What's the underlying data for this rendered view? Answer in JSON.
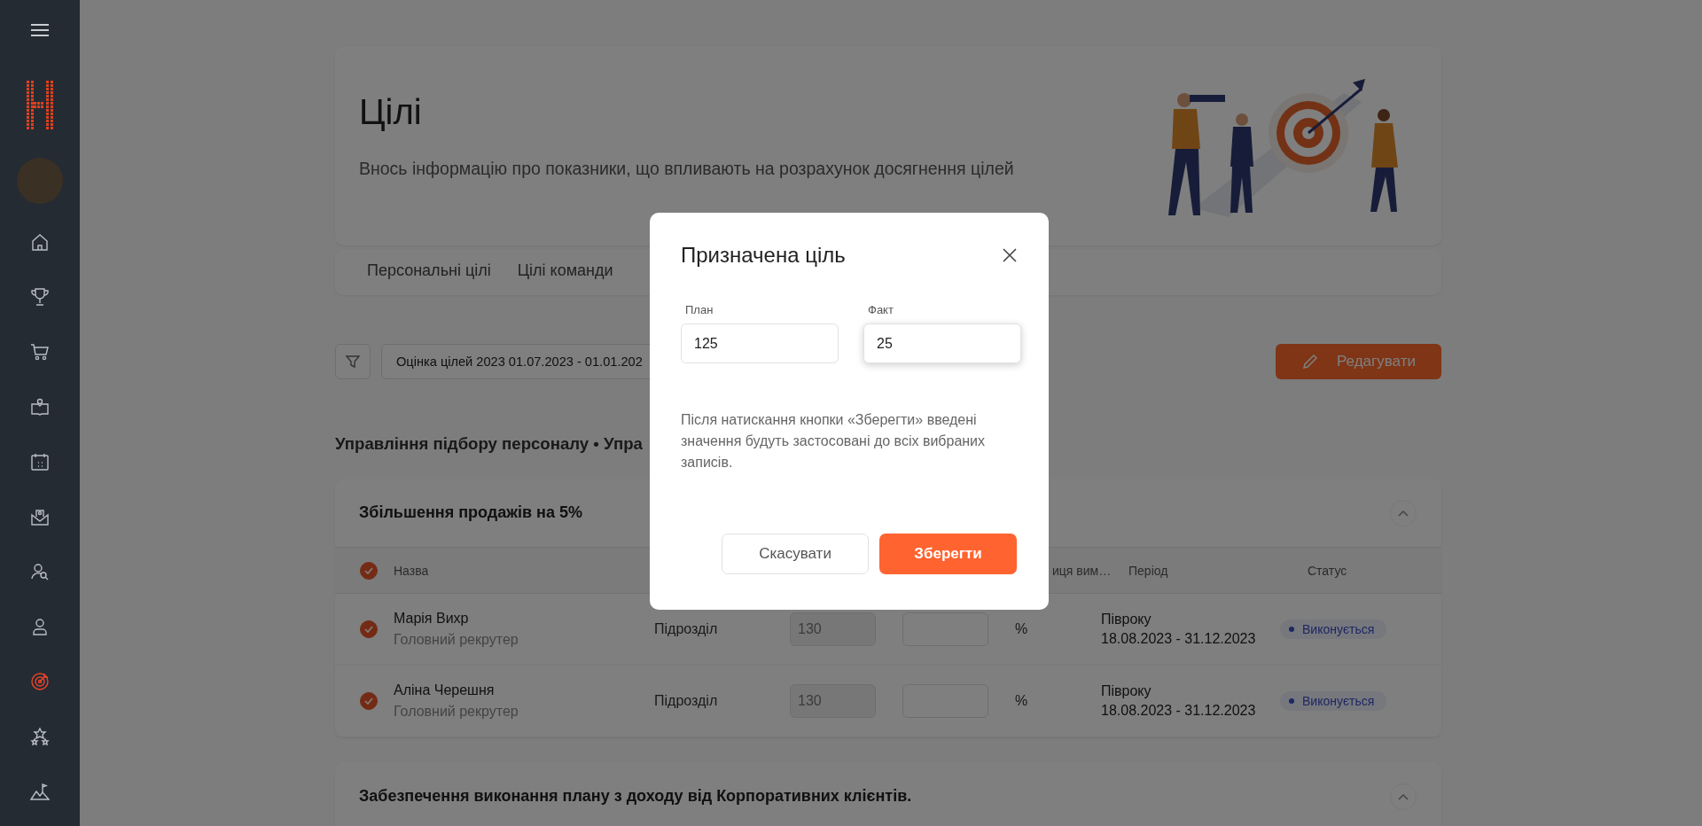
{
  "page": {
    "title": "Цілі",
    "subtitle": "Внось інформацію про показники, що впливають на розрахунок досягнення цілей"
  },
  "tabs": [
    {
      "label": "Персональні цілі",
      "selected": false
    },
    {
      "label": "Цілі команди",
      "selected": false
    }
  ],
  "filter": {
    "value": "Оцінка цілей 2023 01.07.2023 - 01.01.202"
  },
  "edit_button": "Редагувати",
  "section_title": "Управління підбору персоналу • Упра",
  "groups": [
    {
      "title": "Збільшення продажів на 5%",
      "expanded": true,
      "header_checked": true,
      "columns": [
        "Назва",
        "иця вим…",
        "Період",
        "Статус"
      ],
      "rows": [
        {
          "name": "Марія Вихр",
          "role": "Головний рекрутер",
          "checked": true,
          "unit": "Підрозділ",
          "plan": "130",
          "measure": "%",
          "period_label": "Півроку",
          "period": "18.08.2023 - 31.12.2023",
          "status": "Виконується"
        },
        {
          "name": "Аліна Черешня",
          "role": "Головний рекрутер",
          "checked": true,
          "unit": "Підрозділ",
          "plan": "130",
          "measure": "%",
          "period_label": "Півроку",
          "period": "18.08.2023 - 31.12.2023",
          "status": "Виконується"
        }
      ]
    },
    {
      "title": "Забезпечення виконання плану з доходу від Корпоративних клієнтів.",
      "expanded": true
    }
  ],
  "dialog": {
    "title": "Призначена ціль",
    "fields": [
      {
        "label": "План",
        "value": "125",
        "focused": false
      },
      {
        "label": "Факт",
        "value": "25",
        "focused": true
      }
    ],
    "note": "Після натискання кнопки «Зберегти» введені значення будуть застосовані до всіх вибраних записів.",
    "buttons": [
      {
        "label": "Скасувати",
        "kind": "secondary"
      },
      {
        "label": "Зберегти",
        "kind": "primary"
      }
    ]
  }
}
